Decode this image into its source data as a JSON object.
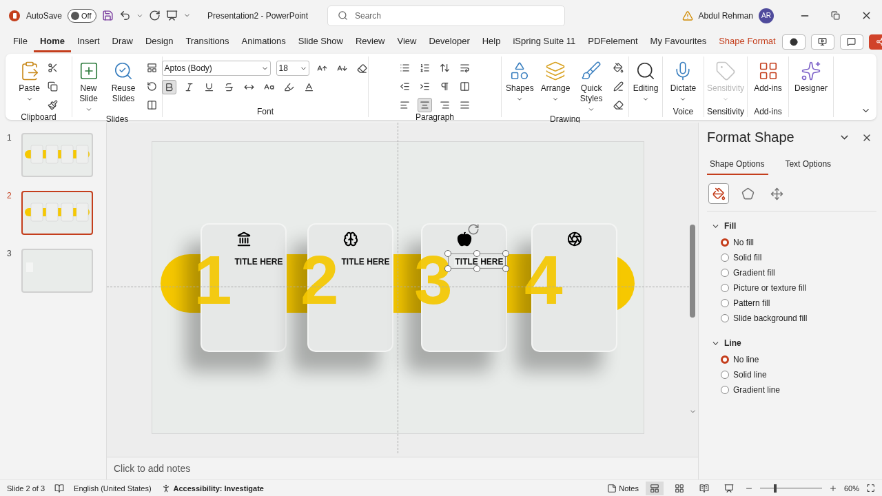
{
  "title_bar": {
    "autosave_label": "AutoSave",
    "autosave": {
      "on": false,
      "label": "Off"
    },
    "document": "Presentation2  -  PowerPoint",
    "search": {
      "placeholder": "Search"
    },
    "user": "Abdul Rehman",
    "initials": "AR"
  },
  "menu": [
    {
      "label": "File",
      "selected": false,
      "contextual": false
    },
    {
      "label": "Home",
      "selected": true,
      "contextual": false
    },
    {
      "label": "Insert",
      "selected": false,
      "contextual": false
    },
    {
      "label": "Draw",
      "selected": false,
      "contextual": false
    },
    {
      "label": "Design",
      "selected": false,
      "contextual": false
    },
    {
      "label": "Transitions",
      "selected": false,
      "contextual": false
    },
    {
      "label": "Animations",
      "selected": false,
      "contextual": false
    },
    {
      "label": "Slide Show",
      "selected": false,
      "contextual": false
    },
    {
      "label": "Review",
      "selected": false,
      "contextual": false
    },
    {
      "label": "View",
      "selected": false,
      "contextual": false
    },
    {
      "label": "Developer",
      "selected": false,
      "contextual": false
    },
    {
      "label": "Help",
      "selected": false,
      "contextual": false
    },
    {
      "label": "iSpring Suite 11",
      "selected": false,
      "contextual": false
    },
    {
      "label": "PDFelement",
      "selected": false,
      "contextual": false
    },
    {
      "label": "My Favourites",
      "selected": false,
      "contextual": false
    },
    {
      "label": "Shape Format",
      "selected": false,
      "contextual": true
    }
  ],
  "ribbon": {
    "groups": [
      {
        "kind": "clipboard",
        "label": "Clipboard",
        "buttons": [
          {
            "label": "Paste",
            "disabled": false
          }
        ]
      },
      {
        "kind": "slides",
        "label": "Slides",
        "buttons": [
          {
            "label": "New Slide",
            "disabled": false
          },
          {
            "label": "Reuse Slides",
            "disabled": false
          }
        ]
      },
      {
        "kind": "font",
        "label": "Font",
        "font_name": "Aptos (Body)",
        "font_size": "18",
        "bold": true
      },
      {
        "kind": "paragraph",
        "label": "Paragraph",
        "alignment": [
          {
            "selected": false
          },
          {
            "selected": true
          },
          {
            "selected": false
          },
          {
            "selected": false
          }
        ]
      },
      {
        "kind": "drawing",
        "label": "Drawing",
        "buttons": [
          {
            "label": "Shapes",
            "disabled": false
          },
          {
            "label": "Arrange",
            "disabled": false
          },
          {
            "label": "Quick Styles",
            "disabled": false
          }
        ]
      },
      {
        "kind": "editing",
        "buttons": [
          {
            "label": "Editing",
            "disabled": false
          }
        ]
      },
      {
        "kind": "voice",
        "label": "Voice",
        "buttons": [
          {
            "label": "Dictate",
            "disabled": false
          }
        ]
      },
      {
        "kind": "sensitivity",
        "label": "Sensitivity",
        "buttons": [
          {
            "label": "Sensitivity",
            "disabled": true
          }
        ]
      },
      {
        "kind": "addins",
        "label": "Add-ins",
        "buttons": [
          {
            "label": "Add-ins",
            "disabled": false
          }
        ]
      },
      {
        "kind": "designer",
        "buttons": [
          {
            "label": "Designer",
            "disabled": false
          }
        ]
      }
    ]
  },
  "thumbnails": [
    {
      "number": "1",
      "kind": "cards",
      "selected": false
    },
    {
      "number": "2",
      "kind": "cards",
      "selected": true
    },
    {
      "number": "3",
      "kind": "blank",
      "selected": false
    }
  ],
  "slide": {
    "cards": [
      {
        "number": "1",
        "title": "TITLE HERE",
        "selected": false
      },
      {
        "number": "2",
        "title": "TITLE HERE",
        "selected": false
      },
      {
        "number": "3",
        "title": "TITLE HERE",
        "selected": true
      },
      {
        "number": "4",
        "selected": false
      }
    ]
  },
  "notes": {
    "placeholder": "Click to add notes"
  },
  "format_pane": {
    "title": "Format Shape",
    "tabs": [
      {
        "label": "Shape Options",
        "selected": true
      },
      {
        "label": "Text Options",
        "selected": false
      }
    ],
    "icon_tabs": [
      {
        "selected": true
      },
      {
        "selected": false
      },
      {
        "selected": false
      }
    ],
    "sections": [
      {
        "title": "Fill",
        "expanded": true,
        "options": [
          {
            "label": "No fill",
            "selected": true
          },
          {
            "label": "Solid fill",
            "selected": false
          },
          {
            "label": "Gradient fill",
            "selected": false
          },
          {
            "label": "Picture or texture fill",
            "selected": false
          },
          {
            "label": "Pattern fill",
            "selected": false
          },
          {
            "label": "Slide background fill",
            "selected": false
          }
        ]
      },
      {
        "title": "Line",
        "expanded": true,
        "options": [
          {
            "label": "No line",
            "selected": true
          },
          {
            "label": "Solid line",
            "selected": false
          },
          {
            "label": "Gradient line",
            "selected": false
          }
        ]
      }
    ]
  },
  "status_bar": {
    "slide": "Slide 2 of 3",
    "language": "English (United States)",
    "accessibility": "Accessibility: Investigate",
    "notes": "Notes",
    "views": [
      {
        "selected": true
      },
      {
        "selected": false
      },
      {
        "selected": false
      },
      {
        "selected": false
      }
    ],
    "zoom_slider": {
      "level": 0.24
    },
    "zoom": "60%"
  }
}
